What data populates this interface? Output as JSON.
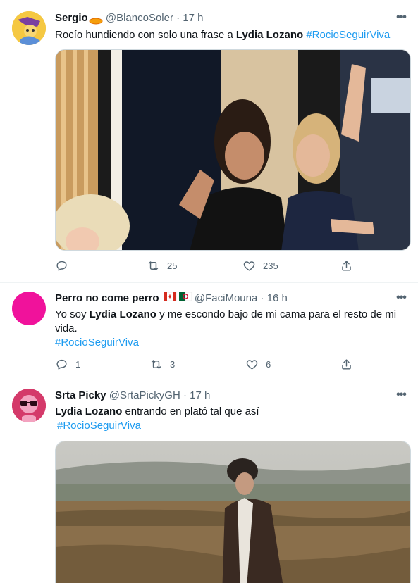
{
  "tweets": [
    {
      "name": "Sergio",
      "handle": "@BlancoSoler",
      "time": "17 h",
      "text_pre": "Rocío hundiendo con solo una frase a ",
      "text_bold": "Lydia Lozano",
      "text_post": " ",
      "hashtag": "#RocioSeguirViva",
      "replies": "",
      "retweets": "25",
      "likes": "235"
    },
    {
      "name": "Perro no come perro",
      "handle": "@FaciMouna",
      "time": "16 h",
      "text_pre": "Yo soy ",
      "text_bold": "Lydia Lozano",
      "text_post": " y me escondo bajo de mi cama para el resto de mi vida.",
      "hashtag": "#RocioSeguirViva",
      "replies": "1",
      "retweets": "3",
      "likes": "6"
    },
    {
      "name": "Srta Picky",
      "handle": "@SrtaPickyGH",
      "time": "17 h",
      "text_bold": "Lydia Lozano",
      "text_post": " entrando en plató tal que así",
      "hashtag": "#RocioSeguirViva"
    }
  ],
  "separator": "·",
  "icons": {
    "reply": "reply-icon",
    "retweet": "retweet-icon",
    "like": "heart-icon",
    "share": "share-icon",
    "more": "more-icon"
  },
  "colors": {
    "hashtag": "#1d9bf0",
    "secondary": "#536471",
    "avatar2": "#f0129b"
  }
}
